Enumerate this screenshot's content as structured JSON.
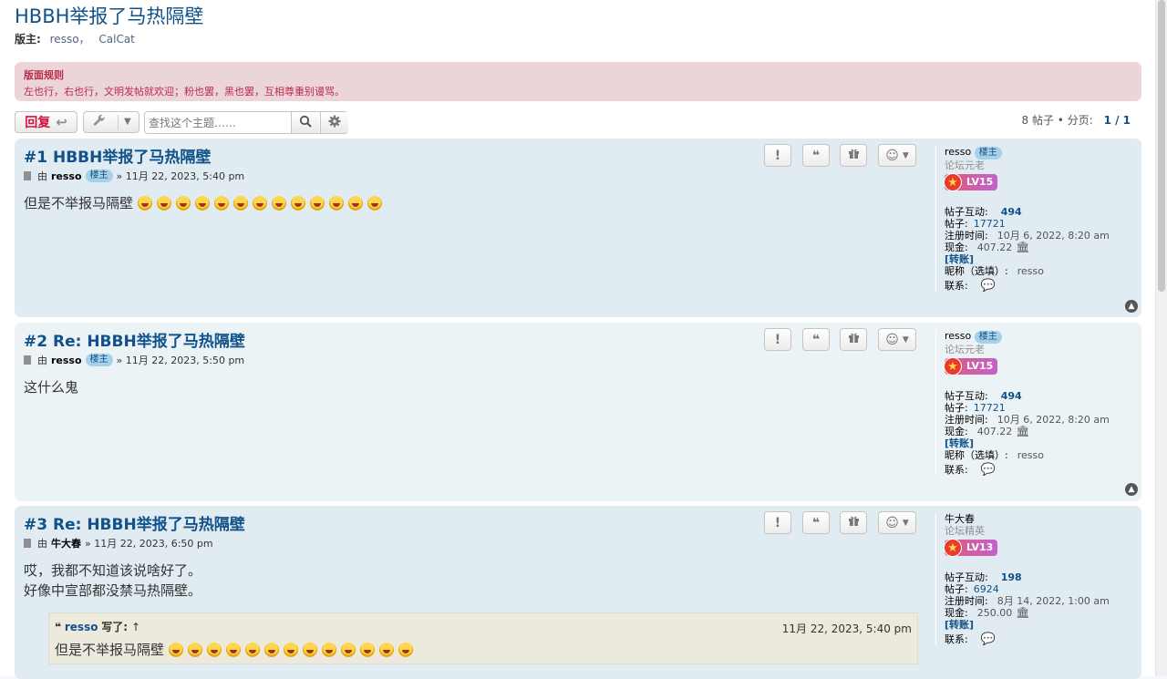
{
  "topic": {
    "title": "HBBH举报了马热隔壁",
    "moderators_label": "版主:",
    "moderators": [
      "resso，",
      "CalCat"
    ]
  },
  "rules": {
    "title": "版面规则",
    "text": "左也行，右也行，文明发帖就欢迎；粉也罢，黑也罢，互相尊重别谩骂。"
  },
  "toolbar": {
    "reply_label": "回复",
    "search_placeholder": "查找这个主题……"
  },
  "pagination": {
    "summary": "8 帖子 • 分页:",
    "pages": "1 / 1"
  },
  "labels": {
    "by": "由",
    "post_count_label": "帖子互动:",
    "posts_label": "帖子:",
    "joined_label": "注册时间:",
    "cash_label": "现金:",
    "transfer": "[转账]",
    "nickname_label": "昵称（选填）:",
    "contact_label": "联系:",
    "quote_wrote": "写了:",
    "quote_up": "↑"
  },
  "posts": [
    {
      "title": "#1 HBBH举报了马热隔壁",
      "author": "resso",
      "badge": "楼主",
      "date": "» 11月 22, 2023, 5:40 pm",
      "body_lines": [
        "但是不举报马隔壁"
      ],
      "emoji_count": 13,
      "profile": {
        "username": "resso",
        "badge": "楼主",
        "rank": "论坛元老",
        "level": "LV15",
        "interactions": "494",
        "posts": "17721",
        "joined": "10月 6, 2022, 8:20 am",
        "cash": "407.22",
        "nickname": "resso"
      }
    },
    {
      "title": "#2 Re: HBBH举报了马热隔壁",
      "author": "resso",
      "badge": "楼主",
      "date": "» 11月 22, 2023, 5:50 pm",
      "body_lines": [
        "这什么鬼"
      ],
      "profile": {
        "username": "resso",
        "badge": "楼主",
        "rank": "论坛元老",
        "level": "LV15",
        "interactions": "494",
        "posts": "17721",
        "joined": "10月 6, 2022, 8:20 am",
        "cash": "407.22",
        "nickname": "resso"
      }
    },
    {
      "title": "#3 Re: HBBH举报了马热隔壁",
      "author": "牛大春",
      "date": "» 11月 22, 2023, 6:50 pm",
      "body_lines": [
        "哎，我都不知道该说啥好了。",
        "好像中宣部都没禁马热隔壁。"
      ],
      "quote": {
        "author": "resso",
        "date": "11月 22, 2023, 5:40 pm",
        "text": "但是不举报马隔壁",
        "emoji_count": 13
      },
      "profile": {
        "username": "牛大春",
        "rank": "论坛精英",
        "level": "LV13",
        "interactions": "198",
        "posts": "6924",
        "joined": "8月 14, 2022, 1:00 am",
        "cash": "250.00"
      }
    }
  ],
  "icons": {
    "reply": "reply-arrow-icon",
    "tools": "wrench-icon",
    "search": "search-icon",
    "advanced": "gear-icon",
    "report": "exclamation-icon",
    "quote": "quote-icon",
    "gift": "gift-icon",
    "react": "smiley-icon",
    "top": "chevron-up-icon",
    "bank": "bank-icon",
    "chat": "chat-bubble-icon"
  }
}
